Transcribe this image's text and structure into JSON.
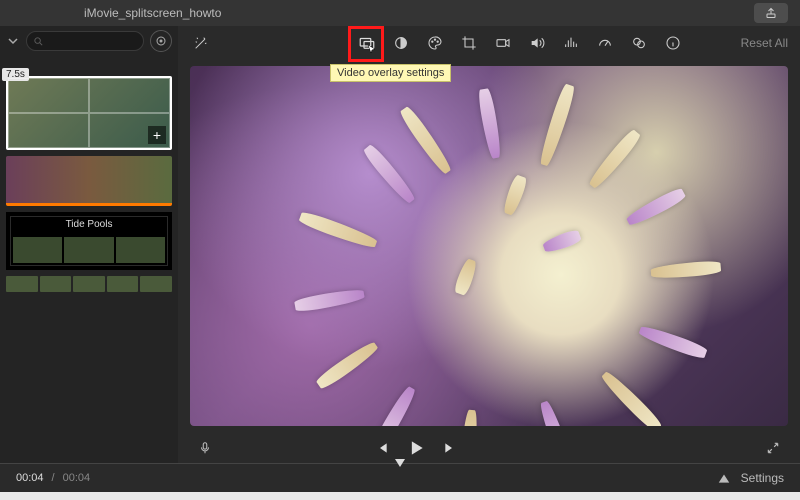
{
  "window": {
    "title": "iMovie_splitscreen_howto"
  },
  "sidebar": {
    "search_placeholder": "",
    "clip_duration": "7.5s",
    "title_card_label": "Tide Pools"
  },
  "toolbar": {
    "tooltip": "Video overlay settings",
    "reset_label": "Reset All",
    "icons": [
      "enhance",
      "overlay",
      "color-balance",
      "color-correction",
      "crop",
      "stabilize",
      "volume",
      "noise-reduce",
      "speed",
      "filter",
      "info"
    ]
  },
  "playback": {
    "time_current": "00:04",
    "time_total": "00:04",
    "settings_label": "Settings"
  }
}
